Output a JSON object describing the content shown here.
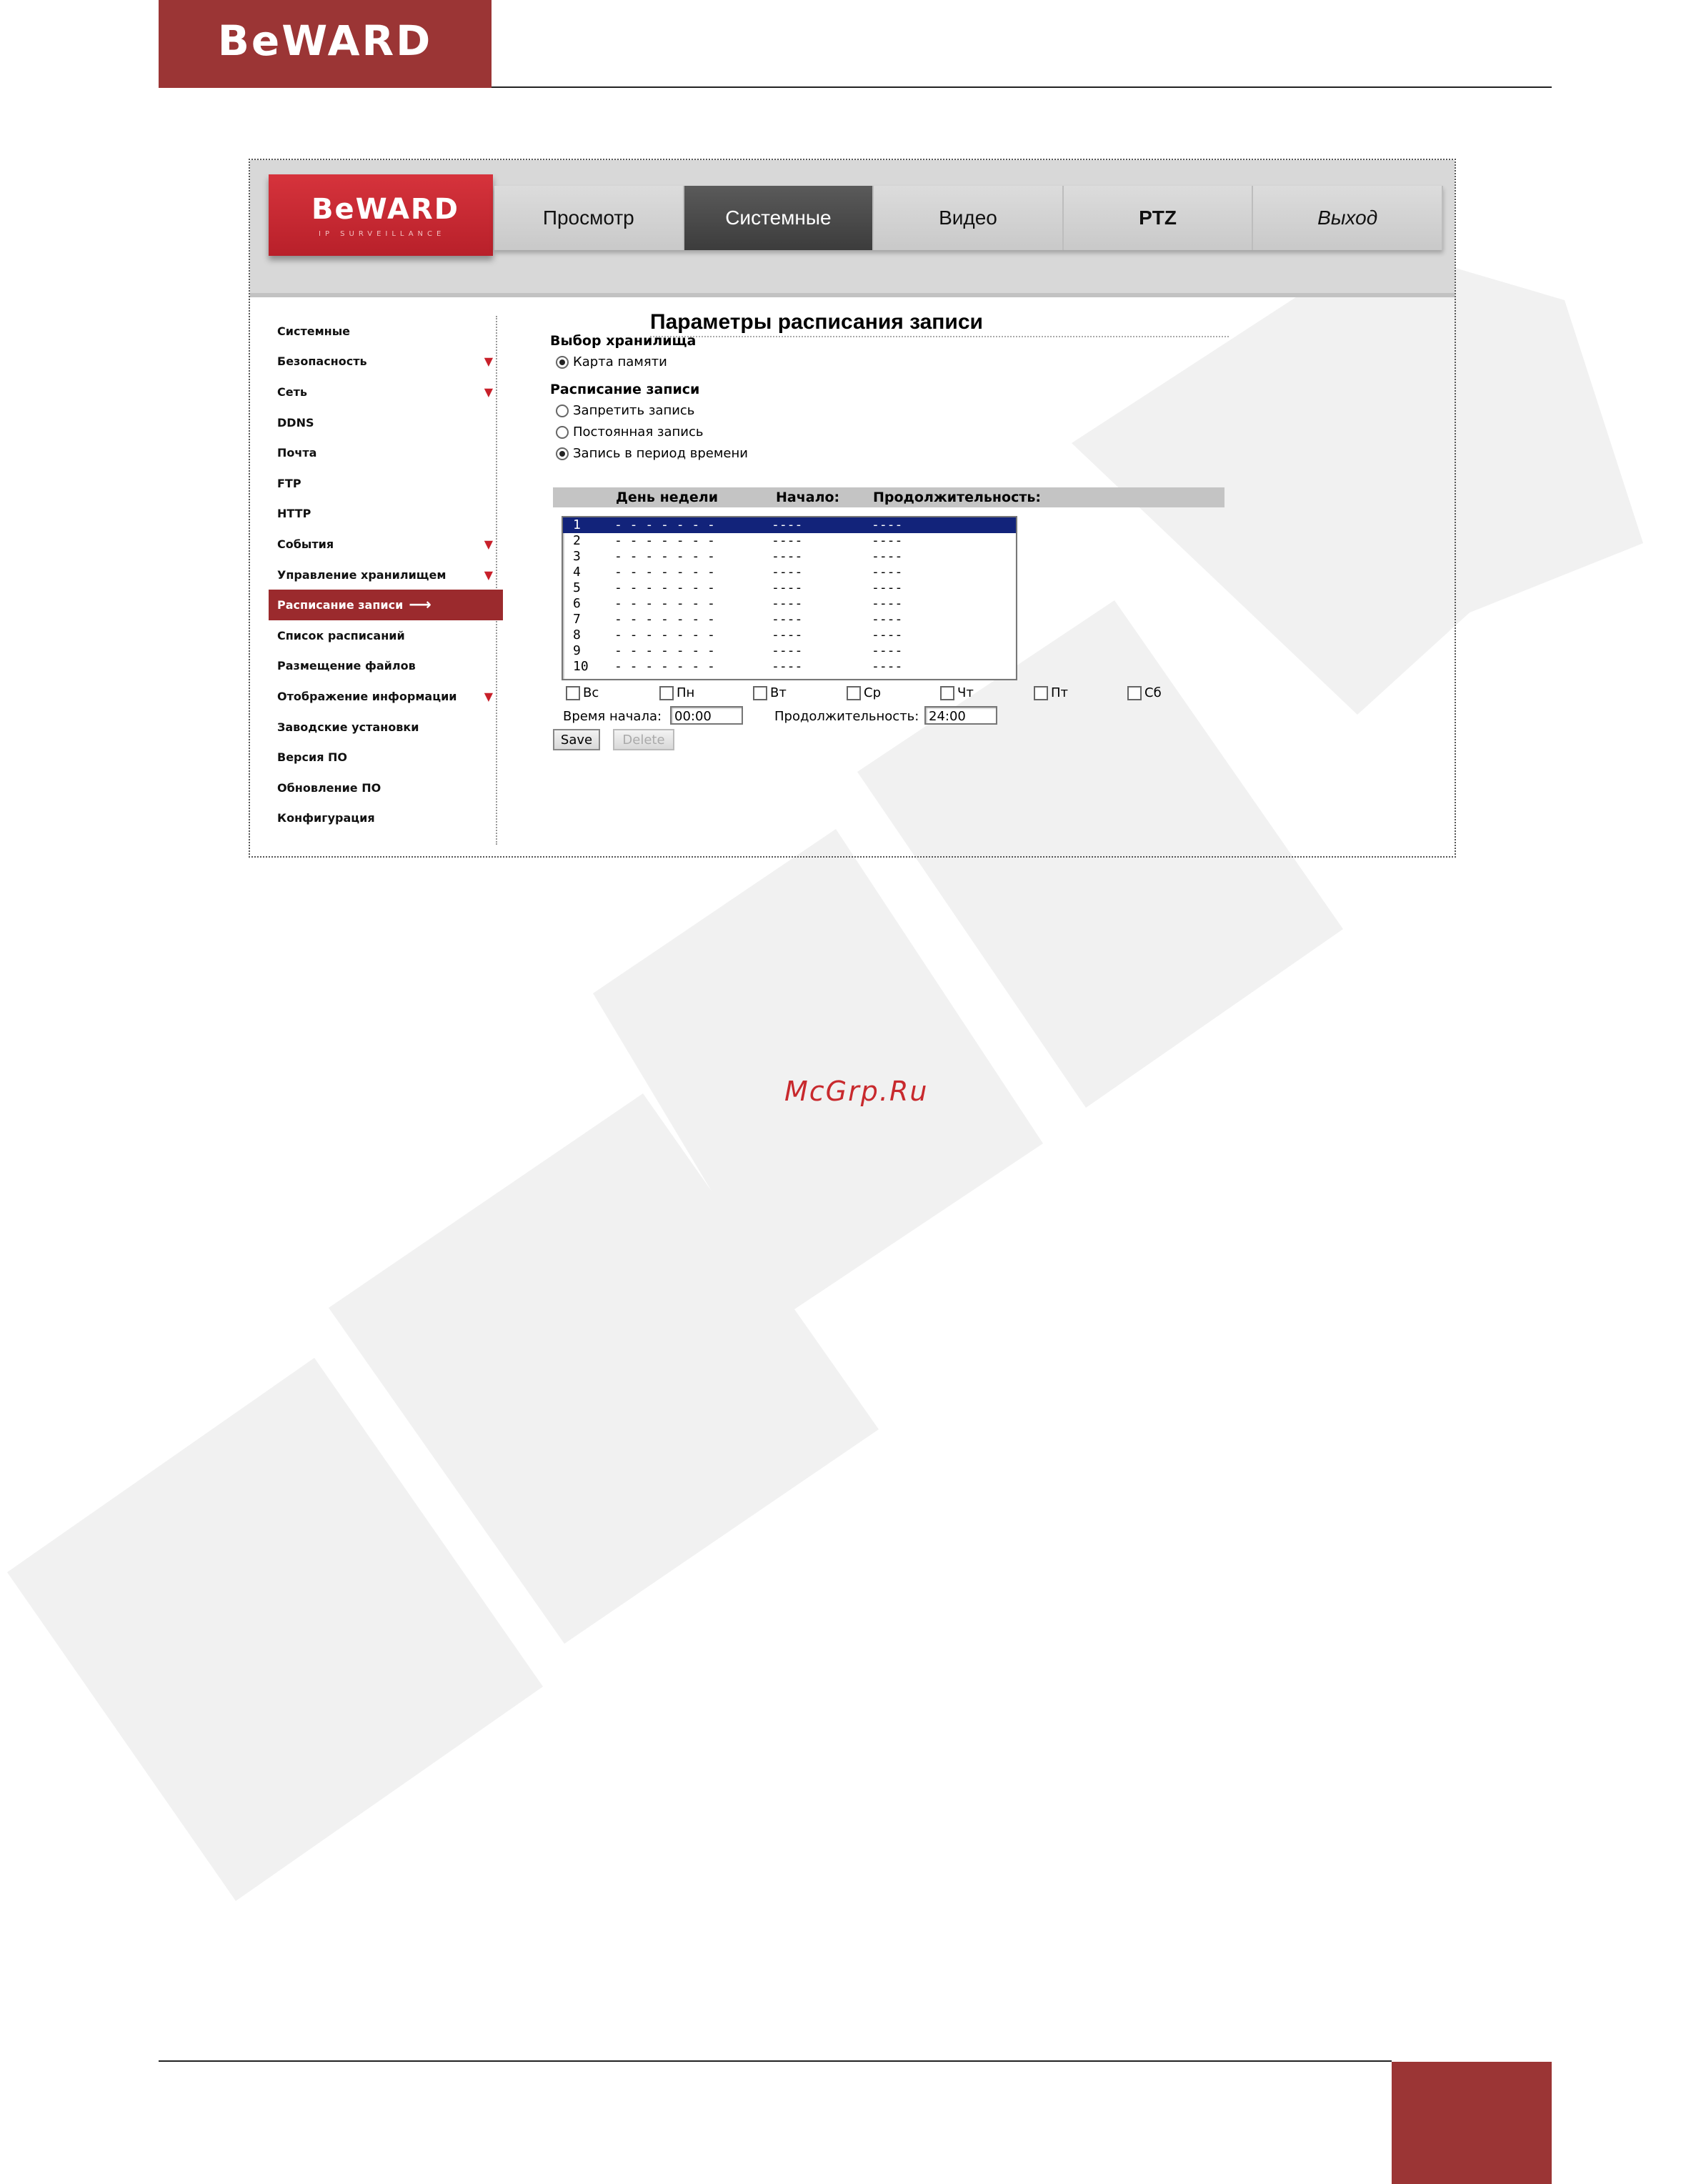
{
  "doc": {
    "brand": "BeWARD",
    "watermark_site": "McGrp.Ru",
    "colors": {
      "brand_red": "#9b3535"
    }
  },
  "ui": {
    "logo_text": "BeWARD",
    "logo_sub": "IP SURVEILLANCE",
    "nav": [
      "Просмотр",
      "Системные",
      "Видео",
      "PTZ",
      "Выход"
    ],
    "active_nav": "Системные",
    "sidebar": [
      {
        "label": "Системные",
        "arrow": ""
      },
      {
        "label": "Безопасность",
        "arrow": "▼"
      },
      {
        "label": "Сеть",
        "arrow": "▼"
      },
      {
        "label": "DDNS",
        "arrow": ""
      },
      {
        "label": "Почта",
        "arrow": ""
      },
      {
        "label": "FTP",
        "arrow": ""
      },
      {
        "label": "HTTP",
        "arrow": ""
      },
      {
        "label": "События",
        "arrow": "▼"
      },
      {
        "label": "Управление хранилищем",
        "arrow": "▼"
      },
      {
        "label": "Расписание записи",
        "arrow": "",
        "active": true
      },
      {
        "label": "Список расписаний",
        "arrow": ""
      },
      {
        "label": "Размещение файлов",
        "arrow": ""
      },
      {
        "label": "Отображение информации",
        "arrow": "▼"
      },
      {
        "label": "Заводские установки",
        "arrow": ""
      },
      {
        "label": "Версия ПО",
        "arrow": ""
      },
      {
        "label": "Обновление ПО",
        "arrow": ""
      },
      {
        "label": "Конфигурация",
        "arrow": ""
      }
    ],
    "active_arrow": "⟶",
    "page_title": "Параметры расписания записи",
    "storage_section": "Выбор хранилища",
    "storage_option": "Карта памяти",
    "schedule_section": "Расписание записи",
    "schedule_options": [
      "Запретить запись",
      "Постоянная запись",
      "Запись в период времени"
    ],
    "selected_schedule": 2,
    "table_headers": [
      "День недели",
      "Начало:",
      "Продолжительность:"
    ],
    "rows": [
      {
        "num": "1",
        "days": "- - - - - - -",
        "start": "----",
        "dur": "----"
      },
      {
        "num": "2",
        "days": "- - - - - - -",
        "start": "----",
        "dur": "----"
      },
      {
        "num": "3",
        "days": "- - - - - - -",
        "start": "----",
        "dur": "----"
      },
      {
        "num": "4",
        "days": "- - - - - - -",
        "start": "----",
        "dur": "----"
      },
      {
        "num": "5",
        "days": "- - - - - - -",
        "start": "----",
        "dur": "----"
      },
      {
        "num": "6",
        "days": "- - - - - - -",
        "start": "----",
        "dur": "----"
      },
      {
        "num": "7",
        "days": "- - - - - - -",
        "start": "----",
        "dur": "----"
      },
      {
        "num": "8",
        "days": "- - - - - - -",
        "start": "----",
        "dur": "----"
      },
      {
        "num": "9",
        "days": "- - - - - - -",
        "start": "----",
        "dur": "----"
      },
      {
        "num": "10",
        "days": "- - - - - - -",
        "start": "----",
        "dur": "----"
      }
    ],
    "weekdays": [
      "Вс",
      "Пн",
      "Вт",
      "Ср",
      "Чт",
      "Пт",
      "Сб"
    ],
    "start_label": "Время начала:",
    "start_value": "00:00",
    "duration_label": "Продолжительность:",
    "duration_value": "24:00",
    "save_label": "Save",
    "delete_label": "Delete"
  }
}
